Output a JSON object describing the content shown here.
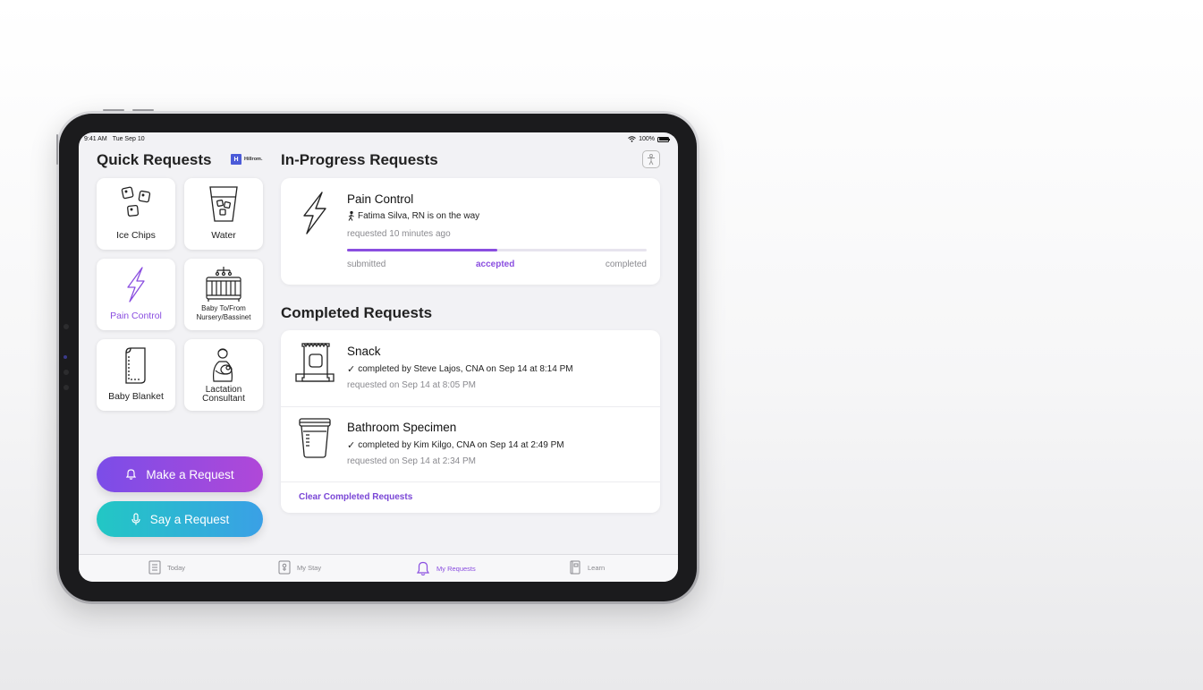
{
  "status_bar": {
    "time": "9:41 AM",
    "date": "Tue Sep 10",
    "battery": "100%"
  },
  "quick_requests": {
    "title": "Quick Requests",
    "brand": "Hillrom.",
    "brand_mark": "H",
    "tiles": [
      {
        "label": "Ice Chips",
        "icon": "ice-cubes-icon"
      },
      {
        "label": "Water",
        "icon": "water-glass-icon"
      },
      {
        "label": "Pain Control",
        "icon": "lightning-icon",
        "selected": true
      },
      {
        "label": "Baby To/From Nursery/Bassinet",
        "icon": "crib-icon"
      },
      {
        "label": "Baby Blanket",
        "icon": "blanket-icon"
      },
      {
        "label": "Lactation Consultant",
        "icon": "nursing-mother-icon"
      }
    ],
    "make_request": "Make a Request",
    "say_request": "Say a Request"
  },
  "in_progress": {
    "title": "In-Progress Requests",
    "item": {
      "name": "Pain Control",
      "status": "Fatima Silva, RN is on the way",
      "time": "requested 10 minutes ago",
      "progress": 0.5,
      "steps": [
        "submitted",
        "accepted",
        "completed"
      ],
      "active_step": "accepted"
    }
  },
  "completed": {
    "title": "Completed Requests",
    "items": [
      {
        "name": "Snack",
        "completed_by": "completed by Steve Lajos, CNA on",
        "completed_at": "Sep 14 at 8:14 PM",
        "requested": "requested on Sep 14 at 8:05 PM",
        "icon": "snack-icon"
      },
      {
        "name": "Bathroom Specimen",
        "completed_by": "completed by Kim Kilgo, CNA on",
        "completed_at": "Sep 14 at 2:49 PM",
        "requested": "requested on Sep 14 at 2:34 PM",
        "icon": "specimen-cup-icon"
      }
    ],
    "clear_label": "Clear Completed Requests"
  },
  "tabs": [
    {
      "label": "Today",
      "icon": "list-icon"
    },
    {
      "label": "My Stay",
      "icon": "stay-icon"
    },
    {
      "label": "My Requests",
      "icon": "bell-icon",
      "active": true
    },
    {
      "label": "Learn",
      "icon": "book-icon"
    }
  ],
  "colors": {
    "accent": "#8a4ee0",
    "make_gradient": [
      "#7b4de8",
      "#b048d8"
    ],
    "say_gradient": [
      "#22c7c4",
      "#3aa0e6"
    ]
  }
}
